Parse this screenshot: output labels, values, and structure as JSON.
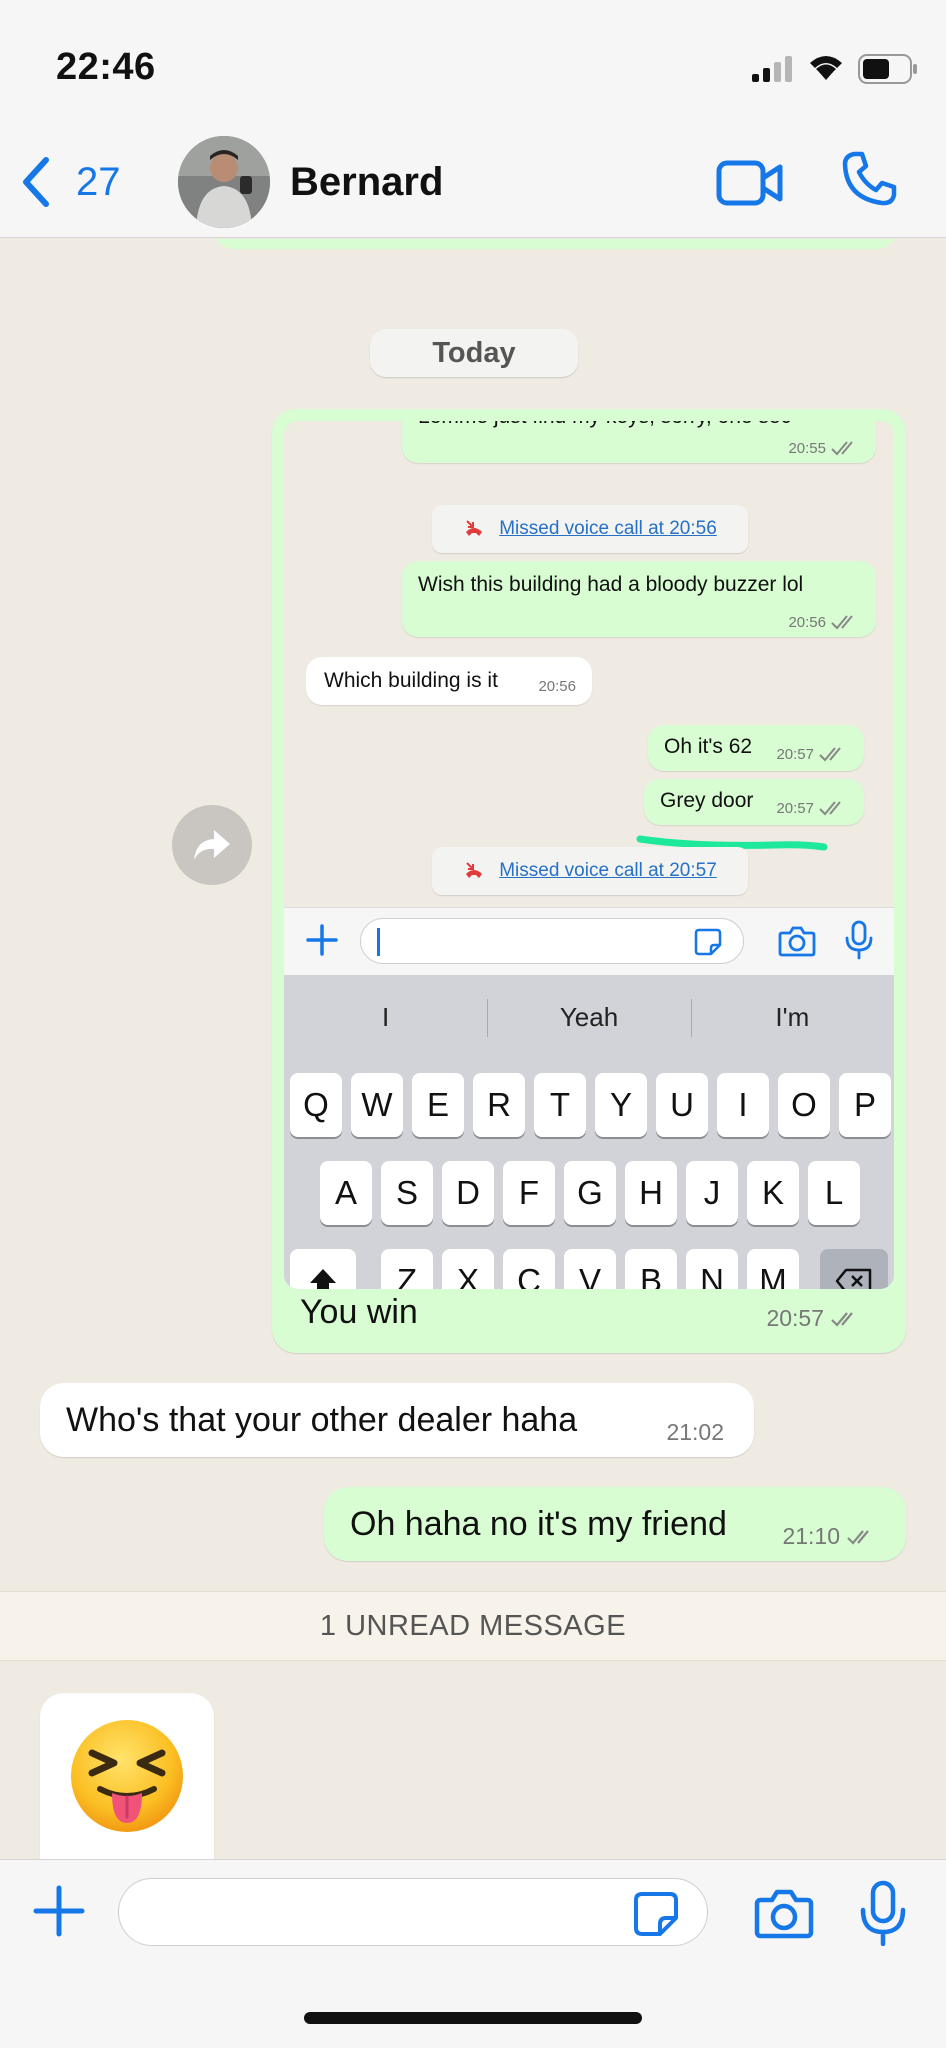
{
  "status_bar": {
    "time": "22:46"
  },
  "header": {
    "back_count": "27",
    "contact_name": "Bernard"
  },
  "chat": {
    "date_label": "Today",
    "image_message": {
      "caption": "You win",
      "time": "20:57",
      "screenshot": {
        "partial_message": {
          "text": "Lemme just find my keys, sorry, one sec",
          "time": "20:55"
        },
        "missed_call_1": "Missed voice call at 20:56",
        "message_building": {
          "text": "Wish this building had a bloody buzzer lol",
          "time": "20:56"
        },
        "reply_which": {
          "text": "Which building is it",
          "time": "20:56"
        },
        "message_62": {
          "text": "Oh it's 62",
          "time": "20:57"
        },
        "message_grey": {
          "text": "Grey door",
          "time": "20:57"
        },
        "missed_call_2": "Missed voice call at 20:57",
        "suggestions": [
          "I",
          "Yeah",
          "I'm"
        ],
        "keys_row1": [
          "Q",
          "W",
          "E",
          "R",
          "T",
          "Y",
          "U",
          "I",
          "O",
          "P"
        ],
        "keys_row2": [
          "A",
          "S",
          "D",
          "F",
          "G",
          "H",
          "J",
          "K",
          "L"
        ],
        "keys_row3": [
          "Z",
          "X",
          "C",
          "V",
          "B",
          "N",
          "M"
        ]
      }
    },
    "incoming_1": {
      "text": "Who's that your other dealer haha",
      "time": "21:02"
    },
    "outgoing_1": {
      "text": "Oh haha no it's my friend",
      "time": "21:10"
    },
    "unread_banner": "1 UNREAD MESSAGE",
    "emoji_message": {
      "emoji": "squinting-face-with-tongue"
    }
  },
  "input_bar": {
    "value": "",
    "placeholder": ""
  },
  "colors": {
    "accent": "#1577e8",
    "outgoing_bubble": "#d8fdd2",
    "chat_bg": "#efeae2",
    "highlight": "#1ee89a"
  }
}
